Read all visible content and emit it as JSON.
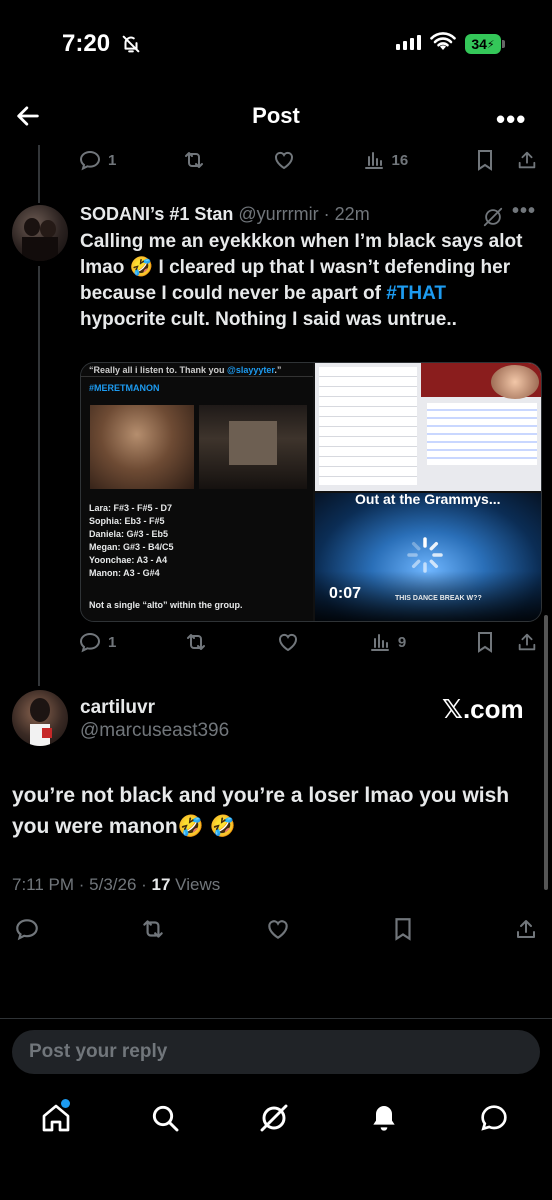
{
  "status_bar": {
    "time": "7:20",
    "battery": "34"
  },
  "header": {
    "title": "Post"
  },
  "parent_top_actions": {
    "replies": "1",
    "views": "16"
  },
  "reply_tweet": {
    "display_name": "SODANI’s #1 Stan",
    "handle": "@yurrrmir",
    "separator": " · ",
    "time": "22m",
    "text_part1": "Calling me an eyekkkon when I’m black says alot lmao 🤣 I cleared up that I wasn’t defending her because I could never be apart of ",
    "hashtag": "#THAT",
    "text_part2": "  hypocrite cult. Nothing I said was untrue..",
    "media": {
      "left_quote_prefix": "“Really all i listen to. Thank you ",
      "left_quote_mention": "@slayyyter",
      "left_quote_suffix": ".”",
      "left_tag": "#MERETMANON",
      "ranges": [
        "Lara: F#3 - F#5 - D7",
        "Sophia: Eb3 - F#5",
        "Daniela: G#3 - Eb5",
        "Megan: G#3 - B4/C5",
        "Yoonchae: A3 - A4",
        "Manon: A3 - G#4"
      ],
      "left_footer": "Not a single “alto” within the group.",
      "right_bottom_caption": "Out at the Grammys...",
      "video_duration": "0:07",
      "dance_caption": "THIS DANCE BREAK W??"
    },
    "actions": {
      "replies": "1",
      "views": "9"
    }
  },
  "main_tweet": {
    "display_name": "cartiluvr",
    "handle": "@marcuseast396",
    "badge": "𝕏.com",
    "text": "you’re not black and you’re a loser lmao you wish you were manon🤣 🤣",
    "timestamp": "7:11 PM · 5/3/26 · ",
    "views_count": "17",
    "views_label": " Views"
  },
  "reply_input": {
    "placeholder": "Post your reply"
  },
  "bottom_nav": [
    "home-icon",
    "search-icon",
    "grok-icon",
    "notifications-icon",
    "messages-icon"
  ],
  "colors": {
    "accent": "#1d9bf0",
    "muted": "#71767b",
    "text": "#e7e9ea",
    "background": "#000000"
  }
}
